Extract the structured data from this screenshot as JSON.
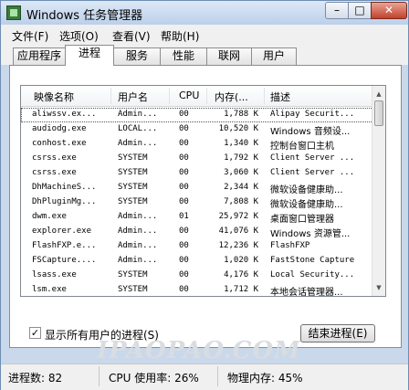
{
  "window": {
    "title": "Windows 任务管理器"
  },
  "title_buttons": {
    "minimize": "–",
    "maximize": "□",
    "close": "✕"
  },
  "menu": [
    "文件(F)",
    "选项(O)",
    "查看(V)",
    "帮助(H)"
  ],
  "tabs": [
    "应用程序",
    "进程",
    "服务",
    "性能",
    "联网",
    "用户"
  ],
  "active_tab": "进程",
  "columns": [
    "映像名称",
    "用户名",
    "CPU",
    "内存(...",
    "描述"
  ],
  "rows": [
    [
      "aliwssv.ex...",
      "Admin...",
      "00",
      "1,788 K",
      "Alipay Securit..."
    ],
    [
      "audiodg.exe",
      "LOCAL...",
      "00",
      "10,520 K",
      "Windows 音频设..."
    ],
    [
      "conhost.exe",
      "Admin...",
      "00",
      "1,340 K",
      "控制台窗口主机"
    ],
    [
      "csrss.exe",
      "SYSTEM",
      "00",
      "1,792 K",
      "Client Server ..."
    ],
    [
      "csrss.exe",
      "SYSTEM",
      "00",
      "3,060 K",
      "Client Server ..."
    ],
    [
      "DhMachineS...",
      "SYSTEM",
      "00",
      "2,344 K",
      "微软设备健康助..."
    ],
    [
      "DhPluginMg...",
      "SYSTEM",
      "00",
      "7,808 K",
      "微软设备健康助..."
    ],
    [
      "dwm.exe",
      "Admin...",
      "01",
      "25,972 K",
      "桌面窗口管理器"
    ],
    [
      "explorer.exe",
      "Admin...",
      "00",
      "41,076 K",
      "Windows 资源管..."
    ],
    [
      "FlashFXP.e...",
      "Admin...",
      "00",
      "12,236 K",
      "FlashFXP"
    ],
    [
      "FSCapture....",
      "Admin...",
      "00",
      "1,020 K",
      "FastStone Capture"
    ],
    [
      "lsass.exe",
      "SYSTEM",
      "00",
      "4,176 K",
      "Local Security..."
    ],
    [
      "lsm.exe",
      "SYSTEM",
      "00",
      "1,712 K",
      "本地会话管理器..."
    ]
  ],
  "show_all_users": {
    "label": "显示所有用户的进程(S)",
    "checked": "✓"
  },
  "end_process_button": "结束进程(E)",
  "status": {
    "processes": "进程数: 82",
    "cpu": "CPU 使用率: 26%",
    "memory": "物理内存: 45%"
  },
  "watermark": "IPAOPAO.COM"
}
